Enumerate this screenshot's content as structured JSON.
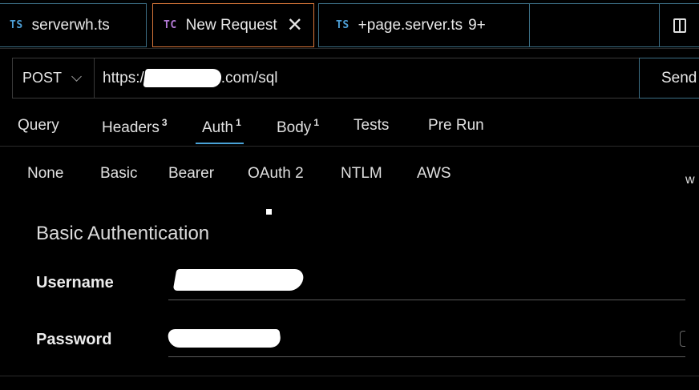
{
  "tabs": [
    {
      "badge": "TS",
      "label": "serverwh.ts"
    },
    {
      "badge": "TC",
      "label": "New Request",
      "close": "✕"
    },
    {
      "badge": "TS",
      "label": "+page.server.ts",
      "count": "9+"
    }
  ],
  "request": {
    "method": "POST",
    "url_prefix": "https:/",
    "url_suffix": ".com/sql",
    "send_label": "Send"
  },
  "request_tabs": [
    {
      "label": "Query",
      "count": ""
    },
    {
      "label": "Headers",
      "count": "3"
    },
    {
      "label": "Auth",
      "count": "1",
      "active": true
    },
    {
      "label": "Body",
      "count": "1"
    },
    {
      "label": "Tests",
      "count": ""
    },
    {
      "label": "Pre Run",
      "count": ""
    }
  ],
  "auth_types": [
    "None",
    "Basic",
    "Bearer",
    "OAuth 2",
    "NTLM",
    "AWS"
  ],
  "auth_extra": "w",
  "basic_auth": {
    "title": "Basic Authentication",
    "username_label": "Username",
    "password_label": "Password"
  },
  "colors": {
    "accent": "#4aa3d8",
    "active_tab_border": "#d9773a",
    "tab_border": "#3c6f86",
    "ts_badge": "#4d9fd6",
    "tc_badge": "#b47ad6"
  },
  "icons": [
    "layout-split-icon",
    "chevron-down-icon",
    "close-icon",
    "eye-icon"
  ]
}
